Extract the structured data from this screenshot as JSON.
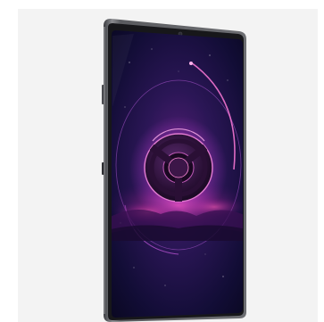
{
  "product": {
    "kind": "tablet",
    "body_color": "#6b6c70",
    "screen_theme": "cosmic-emblem",
    "accent_colors": [
      "#c23dd8",
      "#ff4fc4",
      "#2a1f6e",
      "#0b0a24"
    ]
  }
}
